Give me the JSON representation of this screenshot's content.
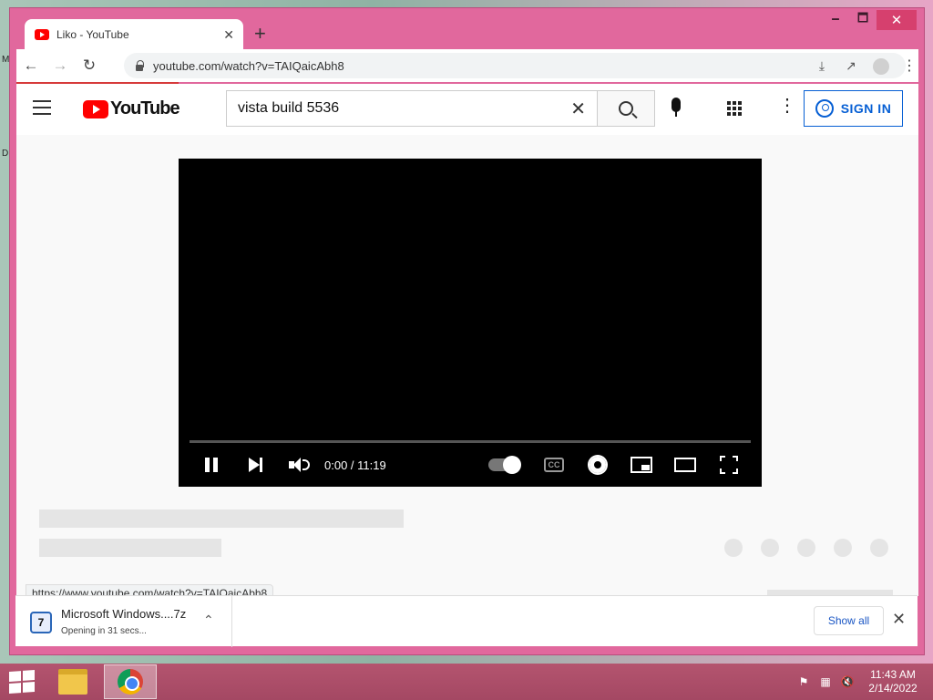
{
  "window": {
    "tab_title": "Liko - YouTube",
    "new_tab": "+",
    "controls": {
      "minimize": "🗕",
      "maximize": "🗖",
      "close": "✕"
    }
  },
  "toolbar": {
    "back": "←",
    "forward": "→",
    "reload": "↻",
    "url": "youtube.com/watch?v=TAIQaicAbh8",
    "menu": "⋮"
  },
  "youtube": {
    "logo_text": "YouTube",
    "search": {
      "value": "vista build 5536",
      "clear": "✕"
    },
    "more": "⋮",
    "sign_in": "SIGN IN"
  },
  "player": {
    "time": "0:00 / 11:19",
    "cc": "CC",
    "progress": 0
  },
  "status_bar": {
    "url": "https://www.youtube.com/watch?v=TAIQaicAbh8"
  },
  "downloads": {
    "file_name": "Microsoft Windows....7z",
    "status": "Opening in 31 secs...",
    "show_all": "Show all",
    "close": "✕"
  },
  "taskbar": {
    "time": "11:43 AM",
    "date": "2/14/2022"
  },
  "colors": {
    "window_frame": "#e1689d",
    "youtube_red": "#ff0000",
    "sign_in_blue": "#065fd4",
    "taskbar": "#a44863"
  }
}
